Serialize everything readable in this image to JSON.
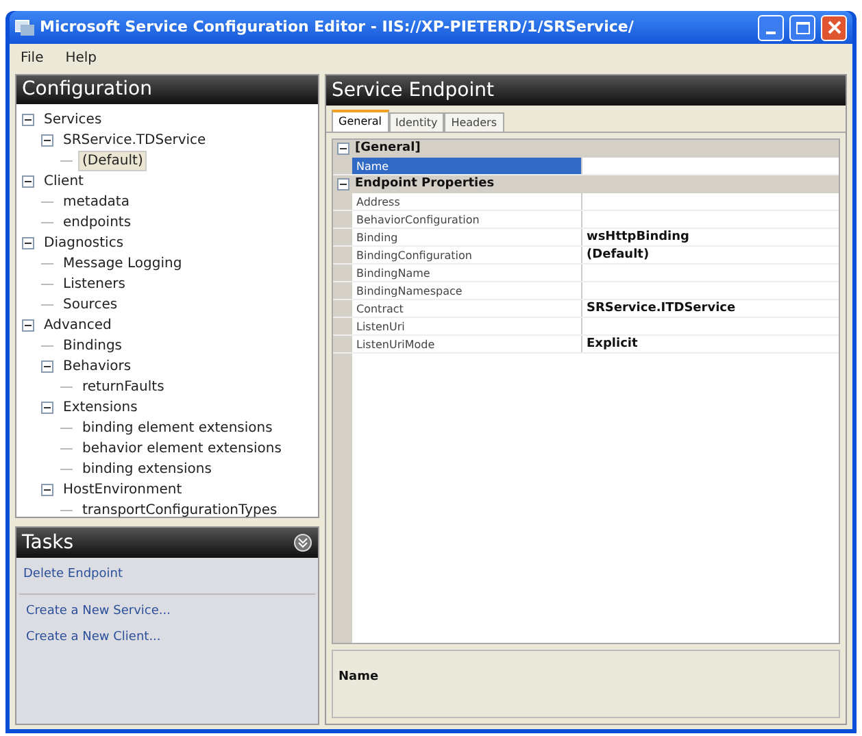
{
  "window": {
    "title": "Microsoft Service Configuration Editor - IIS://XP-PIETERD/1/SRService/"
  },
  "menu": [
    "File",
    "Help"
  ],
  "configuration": {
    "title": "Configuration",
    "tree": [
      {
        "label": "Services",
        "expanded": true,
        "selected": false,
        "children": [
          {
            "label": "SRService.TDService",
            "expanded": true,
            "selected": false,
            "children": [
              {
                "label": "(Default)",
                "selected": true
              }
            ]
          }
        ]
      },
      {
        "label": "Client",
        "expanded": true,
        "selected": false,
        "children": [
          {
            "label": "metadata",
            "selected": false
          },
          {
            "label": "endpoints",
            "selected": false
          }
        ]
      },
      {
        "label": "Diagnostics",
        "expanded": true,
        "selected": false,
        "children": [
          {
            "label": "Message Logging",
            "selected": false
          },
          {
            "label": "Listeners",
            "selected": false
          },
          {
            "label": "Sources",
            "selected": false
          }
        ]
      },
      {
        "label": "Advanced",
        "expanded": true,
        "selected": false,
        "children": [
          {
            "label": "Bindings",
            "selected": false
          },
          {
            "label": "Behaviors",
            "expanded": true,
            "selected": false,
            "children": [
              {
                "label": "returnFaults",
                "selected": false
              }
            ]
          },
          {
            "label": "Extensions",
            "expanded": true,
            "selected": false,
            "children": [
              {
                "label": "binding element extensions",
                "selected": false
              },
              {
                "label": "behavior element extensions",
                "selected": false
              },
              {
                "label": "binding extensions",
                "selected": false
              }
            ]
          },
          {
            "label": "HostEnvironment",
            "expanded": true,
            "selected": false,
            "children": [
              {
                "label": "transportConfigurationTypes",
                "selected": false
              }
            ]
          }
        ]
      }
    ]
  },
  "tasks": {
    "title": "Tasks",
    "groups": [
      [
        "Delete Endpoint"
      ],
      [
        "Create a New Service...",
        "Create a New Client..."
      ]
    ]
  },
  "endpoint": {
    "title": "Service Endpoint",
    "tabs": [
      {
        "label": "General",
        "selected": true
      },
      {
        "label": "Identity",
        "selected": false
      },
      {
        "label": "Headers",
        "selected": false
      }
    ],
    "categories": [
      {
        "label": "[General]",
        "expanded": true,
        "rows": [
          {
            "name": "Name",
            "value": "",
            "selected": true
          }
        ]
      },
      {
        "label": "Endpoint Properties",
        "expanded": true,
        "rows": [
          {
            "name": "Address",
            "value": "",
            "selected": false
          },
          {
            "name": "BehaviorConfiguration",
            "value": "",
            "selected": false
          },
          {
            "name": "Binding",
            "value": "wsHttpBinding",
            "selected": false
          },
          {
            "name": "BindingConfiguration",
            "value": "(Default)",
            "selected": false
          },
          {
            "name": "BindingName",
            "value": "",
            "selected": false
          },
          {
            "name": "BindingNamespace",
            "value": "",
            "selected": false
          },
          {
            "name": "Contract",
            "value": "SRService.ITDService",
            "selected": false
          },
          {
            "name": "ListenUri",
            "value": "",
            "selected": false
          },
          {
            "name": "ListenUriMode",
            "value": "Explicit",
            "selected": false
          }
        ]
      }
    ],
    "description": {
      "title": "Name"
    }
  }
}
